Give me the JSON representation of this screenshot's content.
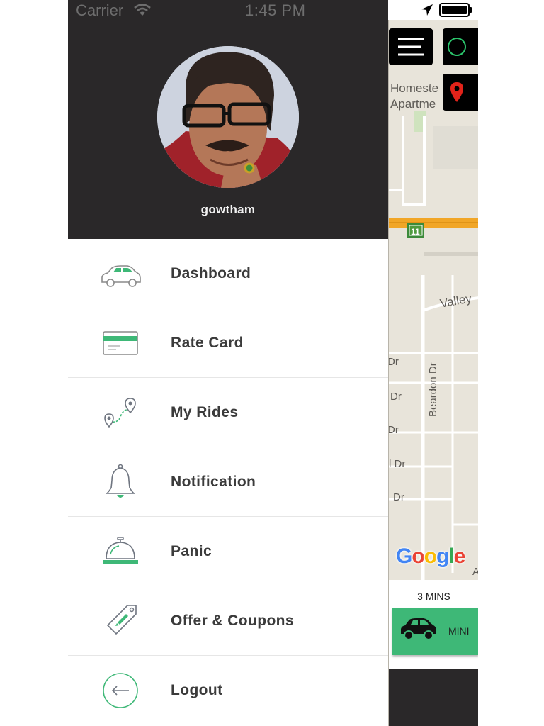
{
  "status_bar": {
    "carrier": "Carrier",
    "time": "1:45 PM"
  },
  "profile": {
    "name": "gowtham"
  },
  "menu": {
    "items": [
      {
        "label": "Dashboard",
        "icon": "car-icon"
      },
      {
        "label": "Rate Card",
        "icon": "card-icon"
      },
      {
        "label": "My Rides",
        "icon": "route-icon"
      },
      {
        "label": "Notification",
        "icon": "bell-icon"
      },
      {
        "label": "Panic",
        "icon": "service-bell-icon"
      },
      {
        "label": "Offer & Coupons",
        "icon": "tag-icon"
      },
      {
        "label": "Logout",
        "icon": "logout-icon"
      }
    ]
  },
  "map": {
    "labels": {
      "homestead_1": "Homeste",
      "homestead_2": "Apartme",
      "highway_shield": "11",
      "valley": "Valley",
      "beardon": "Beardon Dr",
      "dr1": "Dr",
      "dr2": "Dr",
      "dr3": "Dr",
      "dr4": "l Dr",
      "dr5": "Dr",
      "a": "A"
    },
    "google": [
      "G",
      "o",
      "o",
      "g",
      "l",
      "e"
    ]
  },
  "vehicle": {
    "eta": "3 MINS",
    "name": "MINI"
  },
  "colors": {
    "accent": "#3eb877",
    "header_bg": "#2a2829",
    "pin_red": "#e2231a",
    "ring_green": "#2bc46b"
  }
}
